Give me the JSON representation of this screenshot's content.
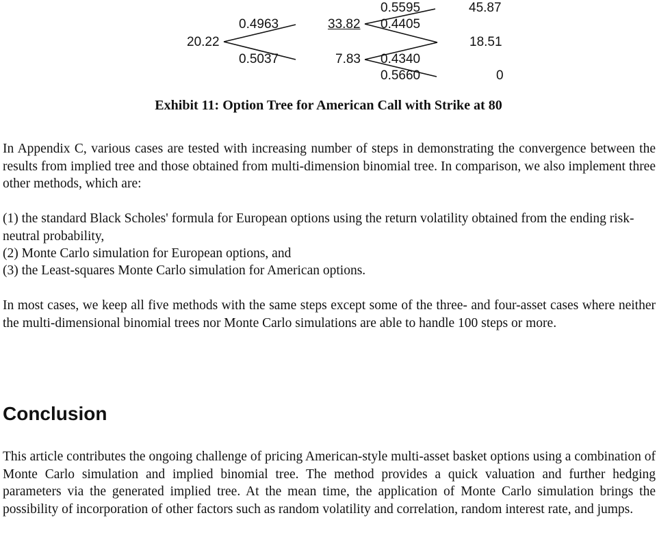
{
  "tree": {
    "root": "20.22",
    "probabilities_step1": {
      "up": "0.4963",
      "down": "0.5037"
    },
    "nodes_step1": {
      "up": "33.82",
      "down": "7.83"
    },
    "probabilities_step2_from_up": {
      "up": "0.5595",
      "down": "0.4405"
    },
    "probabilities_step2_from_down": {
      "up": "0.4340",
      "down": "0.5660"
    },
    "nodes_step2": {
      "top": "45.87",
      "middle": "18.51",
      "bottom": "0"
    }
  },
  "caption": "Exhibit 11: Option Tree for American Call with Strike at 80",
  "paragraphs": {
    "appendix": "In Appendix C, various cases are tested with increasing number of steps in demonstrating the convergence between the results from implied tree and those obtained from multi-dimension binomial tree. In comparison, we also implement three other methods, which are:",
    "methods": [
      "(1) the standard Black Scholes' formula for European options using the return volatility obtained from the ending risk-neutral probability,",
      "(2) Monte Carlo simulation for European options, and",
      "(3) the Least-squares Monte Carlo simulation for American options."
    ],
    "most_cases": "In most cases, we keep all five methods with the same steps except some of the three- and four-asset cases where neither the multi-dimensional binomial trees nor Monte Carlo simulations are able to handle 100 steps or more."
  },
  "conclusion": {
    "heading": "Conclusion",
    "body": "This article contributes the ongoing challenge of pricing American-style multi-asset basket options using a combination of Monte Carlo simulation and implied binomial tree. The method provides a quick valuation and further hedging parameters via the generated implied tree. At the mean time, the application of Monte Carlo simulation brings the possibility of incorporation of other factors such as random volatility and correlation, random interest rate, and jumps."
  }
}
